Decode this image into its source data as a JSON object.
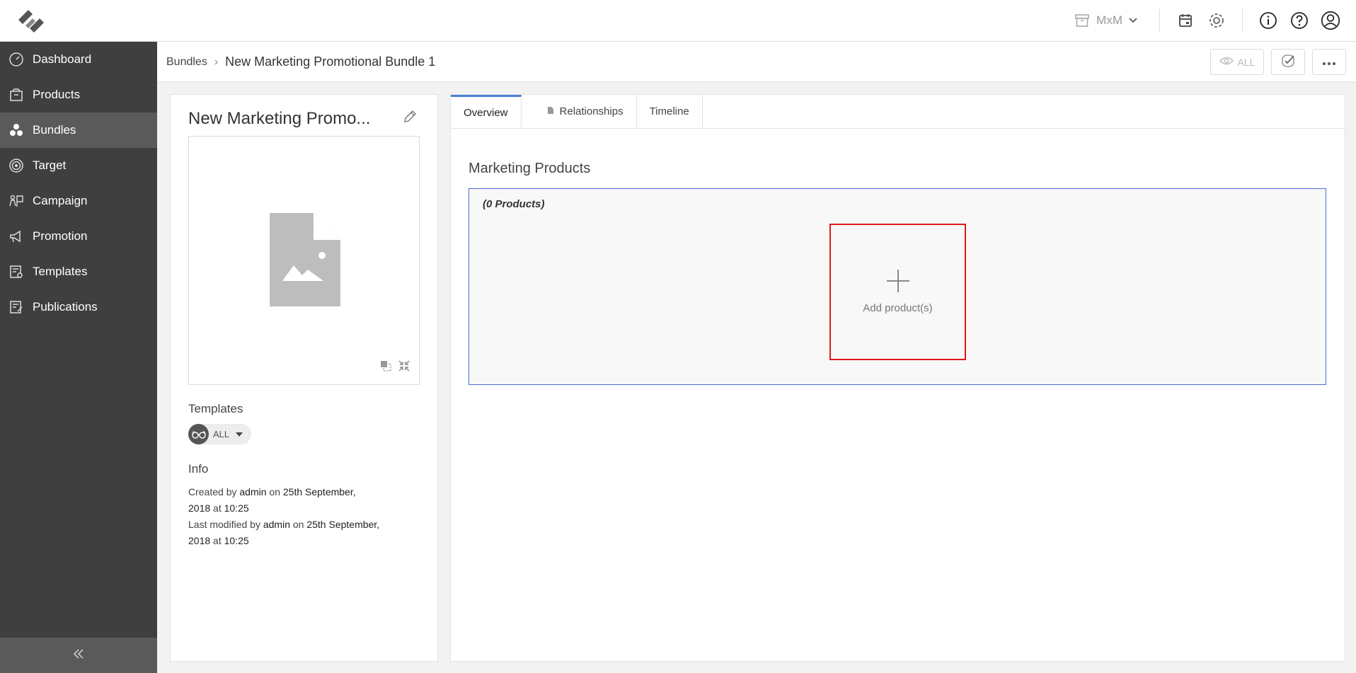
{
  "topbar": {
    "tenant": "MxM"
  },
  "sidebar": {
    "items": [
      {
        "label": "Dashboard",
        "icon": "speedometer-icon"
      },
      {
        "label": "Products",
        "icon": "package-icon"
      },
      {
        "label": "Bundles",
        "icon": "bundles-icon"
      },
      {
        "label": "Target",
        "icon": "target-icon"
      },
      {
        "label": "Campaign",
        "icon": "campaign-icon"
      },
      {
        "label": "Promotion",
        "icon": "megaphone-icon"
      },
      {
        "label": "Templates",
        "icon": "templates-icon"
      },
      {
        "label": "Publications",
        "icon": "publications-icon"
      }
    ],
    "active": "Bundles"
  },
  "breadcrumb": {
    "parent": "Bundles",
    "separator": "›",
    "current": "New Marketing Promotional Bundle 1"
  },
  "toolbar": {
    "view_all": "ALL"
  },
  "details": {
    "title": "New Marketing Promo...",
    "templates_label": "Templates",
    "templates_value": "ALL",
    "info_label": "Info",
    "created_prefix": "Created by",
    "created_user": "admin",
    "created_on": "on",
    "created_date": "25th September,",
    "created_time_line": "2018",
    "created_at": "at",
    "created_time": "10:25",
    "modified_prefix": "Last modified by",
    "modified_user": "admin",
    "modified_on": "on",
    "modified_date": "25th September,",
    "modified_time_line": "2018",
    "modified_at": "at",
    "modified_time": "10:25"
  },
  "tabs": [
    {
      "label": "Overview"
    },
    {
      "label": "Relationships"
    },
    {
      "label": "Timeline"
    }
  ],
  "marketing": {
    "title": "Marketing Products",
    "count": "(0 Products)",
    "add_label": "Add product(s)"
  },
  "colors": {
    "sidebar_bg": "#3f3f3f",
    "sidebar_active": "#5a5a5a",
    "accent_blue": "#4a7fd6",
    "highlight_red": "#e01818"
  }
}
